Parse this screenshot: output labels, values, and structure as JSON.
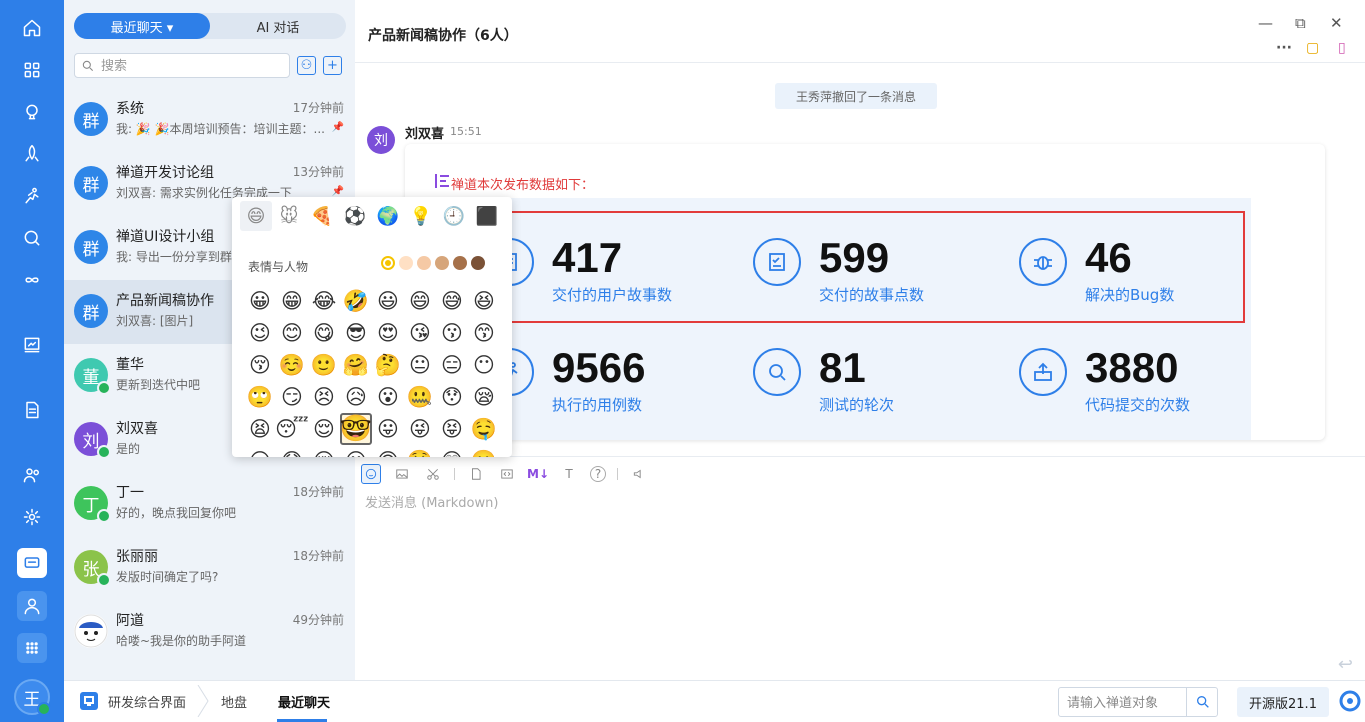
{
  "rail": {
    "icons": [
      "home-icon",
      "grid-icon",
      "lightbulb-icon",
      "rocket-icon",
      "runner-icon",
      "search-circle-icon",
      "infinity-icon",
      "board-icon",
      "document-icon",
      "users-icon",
      "gear-icon",
      "chat-icon",
      "user-icon",
      "apps-icon"
    ],
    "avatar": "王"
  },
  "list": {
    "tabs": [
      "最近聊天 ▾",
      "AI 对话"
    ],
    "search_placeholder": "搜索",
    "conversations": [
      {
        "avatar": "群",
        "color": "#2e86e8",
        "name": "系统",
        "time": "17分钟前",
        "preview": "我: 🎉 🎉本周培训预告：培训主题：...",
        "pinned": true
      },
      {
        "avatar": "群",
        "color": "#2e86e8",
        "name": "禅道开发讨论组",
        "time": "13分钟前",
        "preview": "刘双喜: 需求实例化任务完成一下",
        "pinned": true
      },
      {
        "avatar": "群",
        "color": "#2e86e8",
        "name": "禅道UI设计小组",
        "time": "",
        "preview": "我: 导出一份分享到群",
        "pinned": false
      },
      {
        "avatar": "群",
        "color": "#2e86e8",
        "name": "产品新闻稿协作",
        "time": "",
        "preview": "刘双喜: [图片]",
        "pinned": false
      },
      {
        "avatar": "董",
        "color": "#3fc9b0",
        "name": "董华",
        "time": "",
        "preview": "更新到迭代中吧",
        "pinned": false
      },
      {
        "avatar": "刘",
        "color": "#7b4fd8",
        "name": "刘双喜",
        "time": "",
        "preview": "是的",
        "pinned": false
      },
      {
        "avatar": "丁",
        "color": "#3ec45c",
        "name": "丁一",
        "time": "18分钟前",
        "preview": "好的，晚点我回复你吧",
        "pinned": false
      },
      {
        "avatar": "张",
        "color": "#8bc34a",
        "name": "张丽丽",
        "time": "18分钟前",
        "preview": "发版时间确定了吗?",
        "pinned": false
      },
      {
        "avatar": "",
        "color": "#ffffff",
        "name": "阿道",
        "time": "49分钟前",
        "preview": "哈喽~我是你的助手阿道",
        "pinned": false
      }
    ]
  },
  "chat": {
    "title": "产品新闻稿协作（6人）",
    "system_message": "王秀萍撤回了一条消息",
    "message": {
      "avatar": "刘",
      "sender": "刘双喜",
      "time": "15:51",
      "heading": "禅道本次发布数据如下：",
      "stats": [
        {
          "value": "417",
          "label": "交付的用户故事数",
          "icon": "clipboard-icon"
        },
        {
          "value": "599",
          "label": "交付的故事点数",
          "icon": "checklist-icon"
        },
        {
          "value": "46",
          "label": "解决的Bug数",
          "icon": "bug-icon"
        },
        {
          "value": "9566",
          "label": "执行的用例数",
          "icon": "runner-icon"
        },
        {
          "value": "81",
          "label": "测试的轮次",
          "icon": "magnifier-icon"
        },
        {
          "value": "3880",
          "label": "代码提交的次数",
          "icon": "upload-icon"
        }
      ]
    },
    "composer_placeholder": "发送消息 (Markdown)",
    "toolbar": [
      "emoji-icon",
      "image-icon",
      "scissors-icon",
      "file-icon",
      "code-icon",
      "markdown-icon",
      "font-size-icon",
      "help-icon",
      "broadcast-icon"
    ],
    "toolbar_text": {
      "markdown": "M↓",
      "font": "T",
      "help": "?"
    }
  },
  "emoji": {
    "categories": [
      "😄",
      "🐭",
      "🍕",
      "⚽",
      "🌍",
      "💡",
      "🕘",
      "⬛"
    ],
    "section_title": "表情与人物",
    "tones": [
      "#f5c400",
      "#ffe0c4",
      "#f5c9a5",
      "#d6a57a",
      "#a6714a",
      "#7b5237"
    ],
    "grid": [
      "😀",
      "😁",
      "😂",
      "🤣",
      "😃",
      "😄",
      "😅",
      "😆",
      "😉",
      "😊",
      "😋",
      "😎",
      "😍",
      "😘",
      "😗",
      "😙",
      "😚",
      "☺️",
      "🙂",
      "🤗",
      "🤔",
      "😐",
      "😑",
      "😶",
      "🙄",
      "😏",
      "😣",
      "😥",
      "😮",
      "🤐",
      "😯",
      "😪",
      "😫",
      "😴",
      "😌",
      "🤓",
      "😛",
      "😜",
      "😝",
      "🤤",
      "😒",
      "😓",
      "😔",
      "😕",
      "🙃",
      "🤑",
      "😲",
      "🙁"
    ]
  },
  "bottom": {
    "crumbs": [
      "研发综合界面",
      "地盘",
      "最近聊天"
    ],
    "search_placeholder": "请输入禅道对象",
    "version": "开源版21.1"
  },
  "colors": {
    "brand": "#2e7fe8",
    "highlight": "#e23b3b",
    "online": "#27b35a"
  }
}
